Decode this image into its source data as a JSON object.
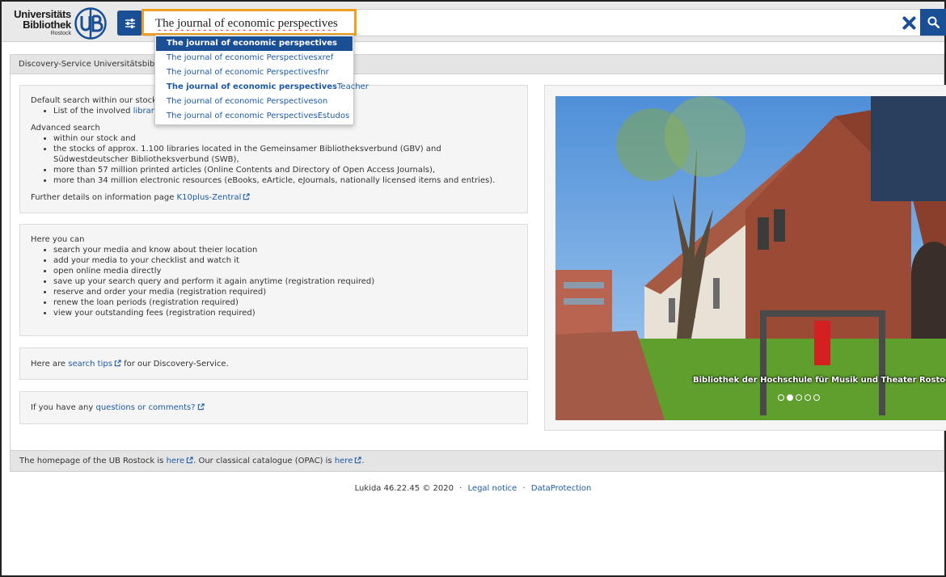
{
  "header": {
    "logo": {
      "line1": "Universitäts",
      "line2": "Bibliothek",
      "line3": "Rostock",
      "seal_text": "UB"
    },
    "filter_icon": "sliders-icon",
    "search": {
      "value": "The journal of economic perspectives",
      "placeholder": ""
    },
    "clear_icon": "close-icon",
    "search_icon": "search-icon"
  },
  "autocomplete": {
    "items": [
      {
        "prefix": "The journal of economic perspectives",
        "suffix": "",
        "active": true
      },
      {
        "prefix": "The journal of economic Perspectives",
        "suffix": "xref"
      },
      {
        "prefix": "The journal of economic Perspectives",
        "suffix": "fnr"
      },
      {
        "prefix": "The journal of economic perspectives",
        "suffix": "Teacher",
        "bold_prefix": true
      },
      {
        "prefix": "The journal of economic Perspectives",
        "suffix": "on"
      },
      {
        "prefix": "The journal of economic Perspectives",
        "suffix": "Estudos"
      }
    ]
  },
  "titlebar": {
    "text": "Discovery-Service Universitätsbibliothek Rostock"
  },
  "panel1": {
    "default_title": "Default search within our stock",
    "default_item_prefix": "List of the involved",
    "default_item_link": "libraries",
    "advanced_title": "Advanced search",
    "advanced_items": [
      "within our stock and",
      "the stocks of approx. 1.100 libraries located in the Gemeinsamer Bibliotheksverbund (GBV) and Südwestdeutscher Bibliotheksverbund (SWB),",
      "more than 57 million printed articles (Online Contents and Directory of Open Access Journals),",
      "more than 34 million electronic resources (eBooks, eArticle, eJournals, nationally licensed items and entries)."
    ],
    "further_prefix": "Further details on information page",
    "further_link": "K10plus-Zentral"
  },
  "panel2": {
    "title": "Here you can",
    "items": [
      "search your media and know about theier location",
      "add your media to your checklist and watch it",
      "open online media directly",
      "save up your search query and perform it again anytime (registration required)",
      "reserve and order your media (registration required)",
      "renew the loan periods (registration required)",
      "view your outstanding fees (registration required)"
    ]
  },
  "panel3": {
    "prefix": "Here are",
    "link": "search tips",
    "suffix": "for our Discovery-Service."
  },
  "panel4": {
    "prefix": "If you have any",
    "link": "questions or comments?"
  },
  "carousel": {
    "caption": "Bibliothek der Hochschule für Musik und Theater Rostock",
    "slides": 5,
    "active_slide": 2
  },
  "bottombar": {
    "prefix": "The homepage of the UB Rostock is",
    "link1": "here",
    "middle": ". Our classical catalogue (OPAC) is",
    "link2": "here",
    "end": "."
  },
  "footer": {
    "version": "Lukida 46.22.45 © 2020",
    "sep": "·",
    "legal": "Legal notice",
    "privacy": "DataProtection"
  },
  "colors": {
    "brand": "#1a4f95",
    "link": "#1d5aa6",
    "focus": "#f0a020"
  }
}
